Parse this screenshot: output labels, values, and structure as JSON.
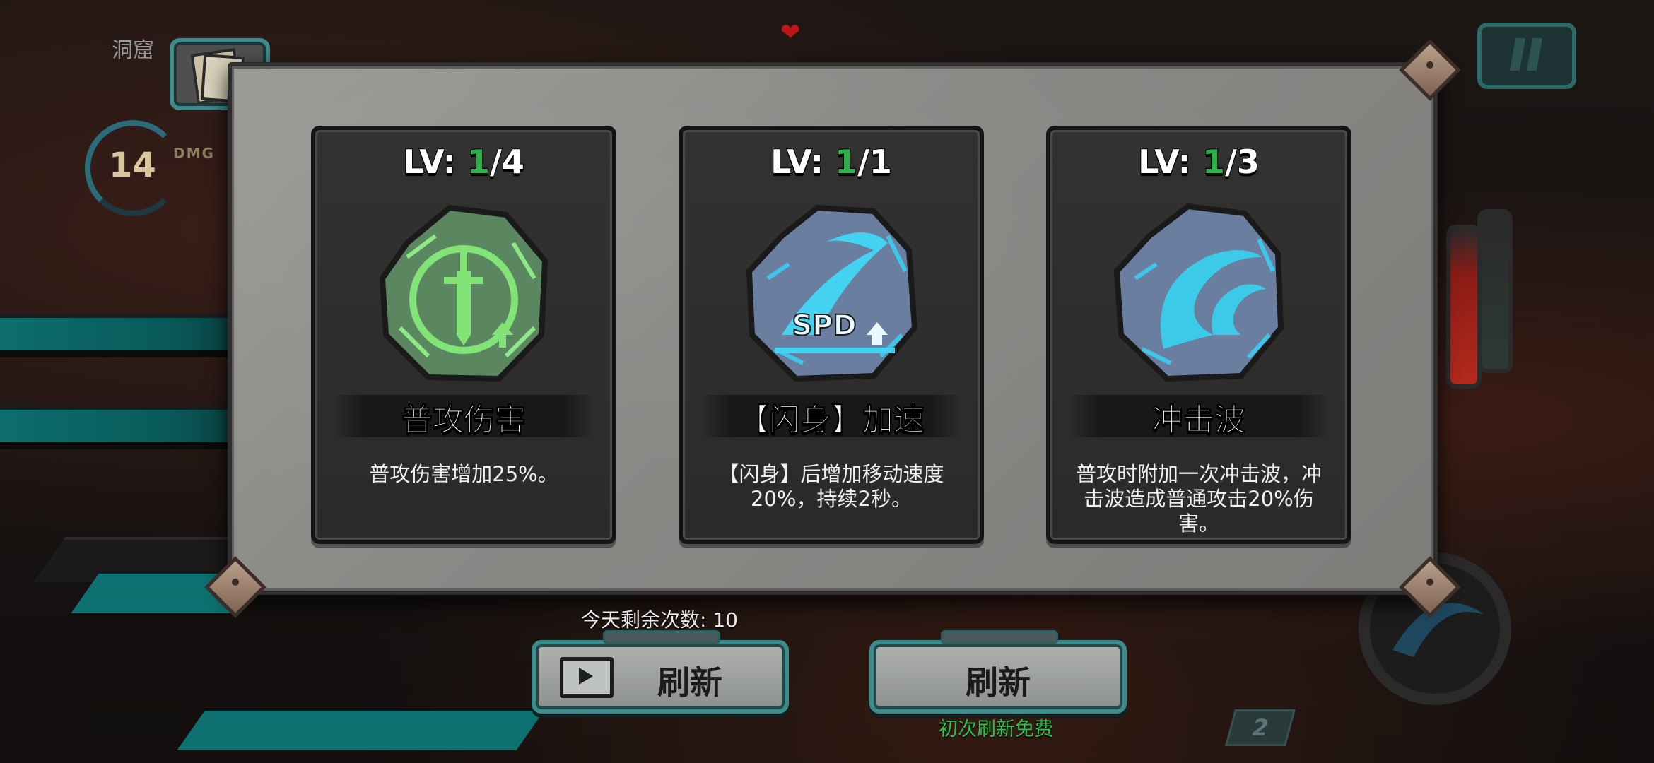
{
  "hud": {
    "location_label": "洞窟",
    "player_level": "14",
    "dmg_label": "DMG",
    "counter": "2",
    "heart_icon": "heart-icon",
    "pause_icon": "pause-icon",
    "notes_icon": "notes-icon"
  },
  "cards": [
    {
      "lv_prefix": "LV: ",
      "lv_current": "1",
      "lv_max": "/4",
      "name": "普攻伤害",
      "desc": "普攻伤害增加25%。",
      "icon": "sword-attack-up-icon",
      "stone_color": "#5d8a5f",
      "glyph_color": "#7ee876"
    },
    {
      "lv_prefix": "LV: ",
      "lv_current": "1",
      "lv_max": "/1",
      "name": "【闪身】加速",
      "desc": "【闪身】后增加移动速度20%，持续2秒。",
      "icon": "speed-up-icon",
      "stone_color": "#6a7fa0",
      "glyph_color": "#4fd6f0",
      "icon_text": "SPD"
    },
    {
      "lv_prefix": "LV: ",
      "lv_current": "1",
      "lv_max": "/3",
      "name": "冲击波",
      "desc": "普攻时附加一次冲击波，冲击波造成普通攻击20%伤害。",
      "icon": "shockwave-icon",
      "stone_color": "#6a7fa0",
      "glyph_color": "#37c9e6"
    }
  ],
  "bottom": {
    "remaining_text": "今天剩余次数: 10",
    "refresh_video_label": "刷新",
    "refresh_free_label": "刷新",
    "free_note": "初次刷新免费",
    "video_icon": "video-play-icon"
  },
  "colors": {
    "accent_teal": "#3a8d8d",
    "level_green": "#2fae4b",
    "free_green": "#2fbf4c"
  }
}
